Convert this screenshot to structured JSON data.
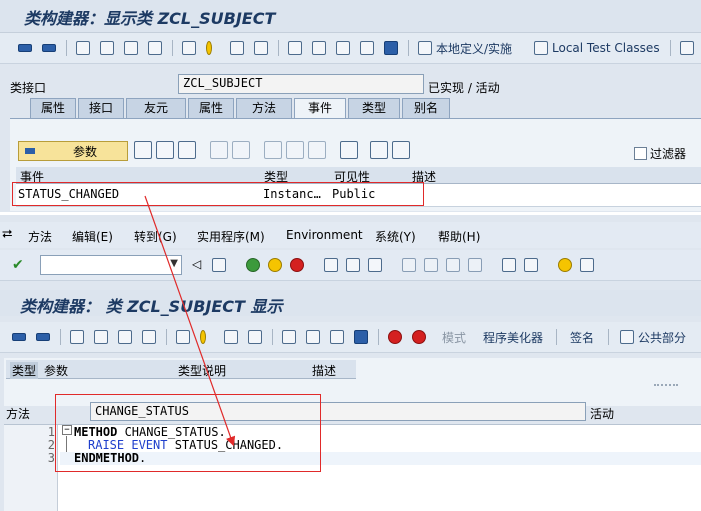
{
  "top": {
    "title": "类构建器：显示类 ZCL_SUBJECT",
    "toolbar": {
      "local_def": "本地定义/实施",
      "local_test": "Local Test Classes"
    },
    "class_interface_label": "类接口",
    "class_interface_value": "ZCL_SUBJECT",
    "status": "已实现 / 活动",
    "tabs": [
      "属性",
      "接口",
      "友元",
      "属性",
      "方法",
      "事件",
      "类型",
      "别名"
    ],
    "active_tab": 5,
    "param_button": "参数",
    "filter_label": "过滤器",
    "grid_headers": [
      "事件",
      "类型",
      "可见性",
      "描述"
    ],
    "grid_row": {
      "event": "STATUS_CHANGED",
      "type": "Instanc…",
      "visibility": "Public",
      "description": ""
    }
  },
  "bottom": {
    "menu": [
      "方法",
      "编辑(E)",
      "转到(G)",
      "实用程序(M)",
      "Environment",
      "系统(Y)",
      "帮助(H)"
    ],
    "title": "类构建器： 类 ZCL_SUBJECT 显示",
    "toolbar": {
      "mode": "模式",
      "pretty_printer": "程序美化器",
      "signature": "签名",
      "public_section": "公共部分"
    },
    "param_cols": [
      "类型",
      "参数",
      "类型说明",
      "描述"
    ],
    "method_label": "方法",
    "method_value": "CHANGE_STATUS",
    "method_status": "活动",
    "code": {
      "line_numbers": [
        "1",
        "2",
        "3"
      ],
      "l1_kw": "METHOD",
      "l1_rest": " CHANGE_STATUS.",
      "l2_kw": "RAISE EVENT",
      "l2_rest": " STATUS_CHANGED.",
      "l3_kw": "ENDMETHOD",
      "l3_rest": "."
    }
  },
  "colors": {
    "highlight_box": "#e02a2a",
    "arrow": "#e02a2a"
  }
}
